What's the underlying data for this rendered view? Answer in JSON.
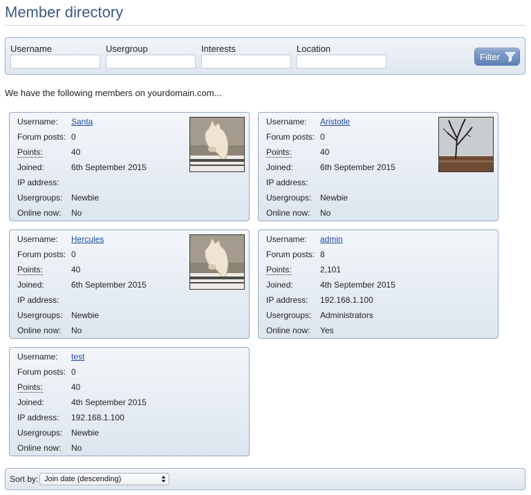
{
  "page": {
    "title": "Member directory",
    "intro": "We have the following members on yourdomain.com..."
  },
  "filters": {
    "fields": [
      {
        "label": "Username",
        "value": ""
      },
      {
        "label": "Usergroup",
        "value": ""
      },
      {
        "label": "Interests",
        "value": ""
      },
      {
        "label": "Location",
        "value": ""
      }
    ],
    "button_label": "Filter"
  },
  "labels": {
    "username": "Username:",
    "forum_posts": "Forum posts:",
    "points": "Points:",
    "joined": "Joined:",
    "ip_address": "IP address:",
    "usergroups": "Usergroups:",
    "online_now": "Online now:"
  },
  "members": [
    {
      "username": "Santa",
      "forum_posts": "0",
      "points": "40",
      "joined": "6th September 2015",
      "ip_address": "",
      "usergroups": "Newbie",
      "online_now": "No",
      "avatar": "horse"
    },
    {
      "username": "Aristotle",
      "forum_posts": "0",
      "points": "40",
      "joined": "6th September 2015",
      "ip_address": "",
      "usergroups": "Newbie",
      "online_now": "No",
      "avatar": "tree"
    },
    {
      "username": "Hercules",
      "forum_posts": "0",
      "points": "40",
      "joined": "6th September 2015",
      "ip_address": "",
      "usergroups": "Newbie",
      "online_now": "No",
      "avatar": "horse"
    },
    {
      "username": "admin",
      "forum_posts": "8",
      "points": "2,101",
      "joined": "4th September 2015",
      "ip_address": "192.168.1.100",
      "usergroups": "Administrators",
      "online_now": "Yes",
      "avatar": ""
    },
    {
      "username": "test",
      "forum_posts": "0",
      "points": "40",
      "joined": "4th September 2015",
      "ip_address": "192.168.1.100",
      "usergroups": "Newbie",
      "online_now": "No",
      "avatar": ""
    }
  ],
  "sort": {
    "label": "Sort by:",
    "selected": "Join date (descending)"
  },
  "colors": {
    "title": "#3d5a80",
    "link": "#1f4a9a",
    "panel_border": "#94a8c2"
  }
}
